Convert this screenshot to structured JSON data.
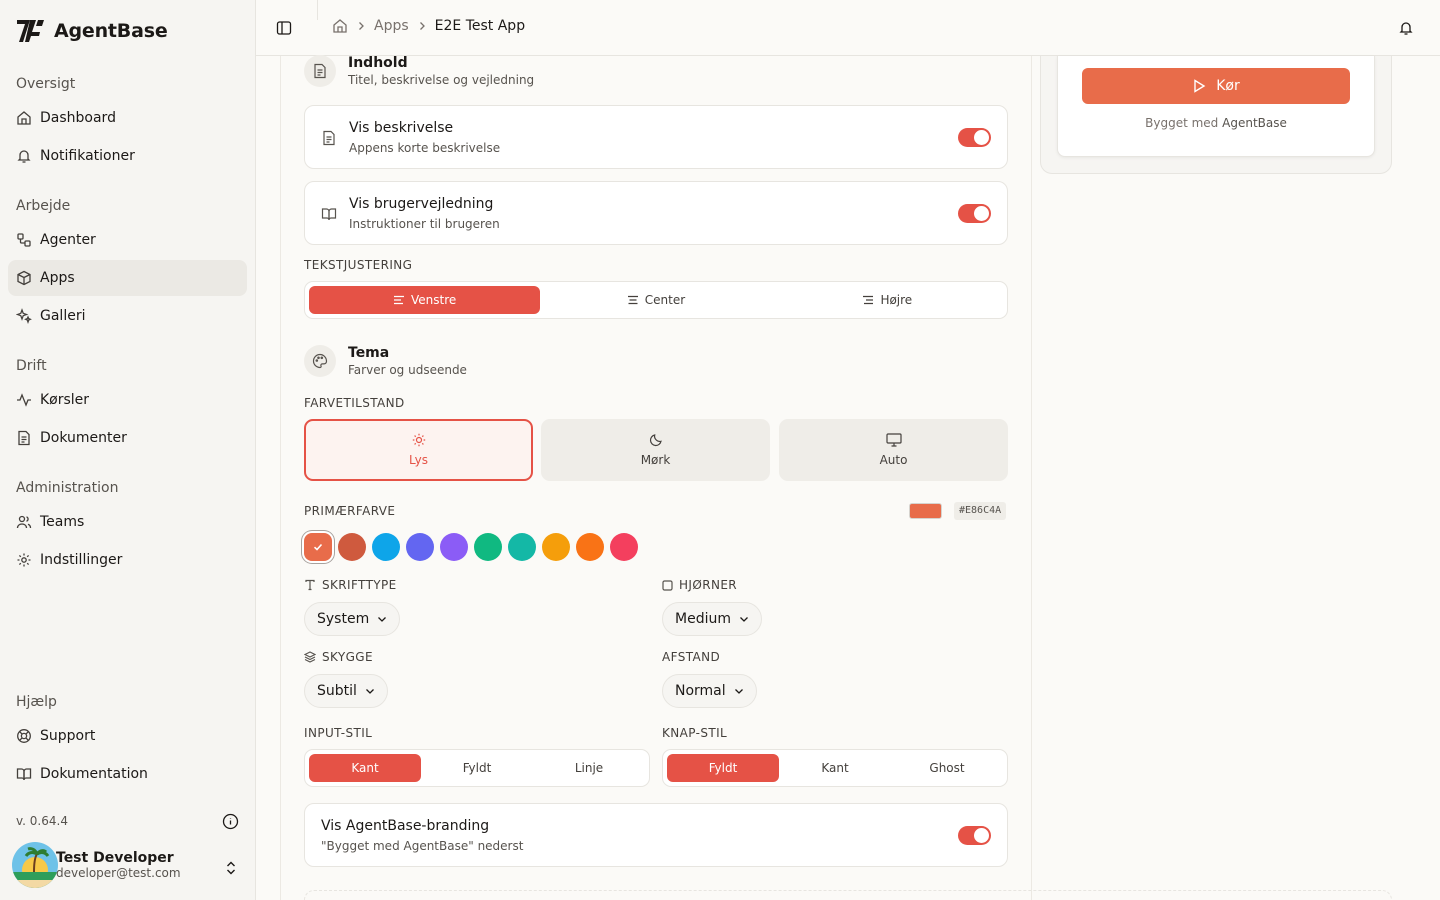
{
  "app": {
    "name": "AgentBase"
  },
  "sidebar": {
    "sections": [
      {
        "title": "Oversigt",
        "items": [
          {
            "label": "Dashboard"
          },
          {
            "label": "Notifikationer"
          }
        ]
      },
      {
        "title": "Arbejde",
        "items": [
          {
            "label": "Agenter"
          },
          {
            "label": "Apps"
          },
          {
            "label": "Galleri"
          }
        ]
      },
      {
        "title": "Drift",
        "items": [
          {
            "label": "Kørsler"
          },
          {
            "label": "Dokumenter"
          }
        ]
      },
      {
        "title": "Administration",
        "items": [
          {
            "label": "Teams"
          },
          {
            "label": "Indstillinger"
          }
        ]
      },
      {
        "title": "Hjælp",
        "items": [
          {
            "label": "Support"
          },
          {
            "label": "Dokumentation"
          }
        ]
      }
    ],
    "active_item": "Apps",
    "version": "v. 0.64.4",
    "user": {
      "name": "Test Developer",
      "email": "developer@test.com"
    }
  },
  "header": {
    "breadcrumbs": [
      "Apps",
      "E2E Test App"
    ]
  },
  "content_section": {
    "title": "Indhold",
    "subtitle": "Titel, beskrivelse og vejledning",
    "show_description": {
      "title": "Vis beskrivelse",
      "subtitle": "Appens korte beskrivelse",
      "enabled": true
    },
    "show_guide": {
      "title": "Vis brugervejledning",
      "subtitle": "Instruktioner til brugeren",
      "enabled": true
    },
    "text_align": {
      "label": "TEKSTJUSTERING",
      "options": [
        "Venstre",
        "Center",
        "Højre"
      ],
      "selected": "Venstre"
    }
  },
  "theme_section": {
    "title": "Tema",
    "subtitle": "Farver og udseende",
    "color_mode": {
      "label": "FARVETILSTAND",
      "options": [
        "Lys",
        "Mørk",
        "Auto"
      ],
      "selected": "Lys"
    },
    "primary_color": {
      "label": "PRIMÆRFARVE",
      "value": "#E86C4A",
      "swatches": [
        "#e86c4a",
        "#cf5a3e",
        "#0ea5e9",
        "#6366f1",
        "#8b5cf6",
        "#10b981",
        "#14b8a6",
        "#f59e0b",
        "#f97316",
        "#f43f5e"
      ],
      "selected_index": 0
    },
    "font": {
      "label": "SKRIFTTYPE",
      "value": "System"
    },
    "corners": {
      "label": "HJØRNER",
      "value": "Medium"
    },
    "shadow": {
      "label": "SKYGGE",
      "value": "Subtil"
    },
    "spacing": {
      "label": "AFSTAND",
      "value": "Normal"
    },
    "input_style": {
      "label": "INPUT-STIL",
      "options": [
        "Kant",
        "Fyldt",
        "Linje"
      ],
      "selected": "Kant"
    },
    "button_style": {
      "label": "KNAP-STIL",
      "options": [
        "Fyldt",
        "Kant",
        "Ghost"
      ],
      "selected": "Fyldt"
    },
    "branding": {
      "title": "Vis AgentBase-branding",
      "subtitle": "\"Bygget med AgentBase\" nederst",
      "enabled": true
    }
  },
  "preview": {
    "run_button": "Kør",
    "built_prefix": "Bygget med",
    "built_brand": "AgentBase"
  },
  "colors": {
    "accent": "#e55246",
    "button": "#e86c4a"
  }
}
